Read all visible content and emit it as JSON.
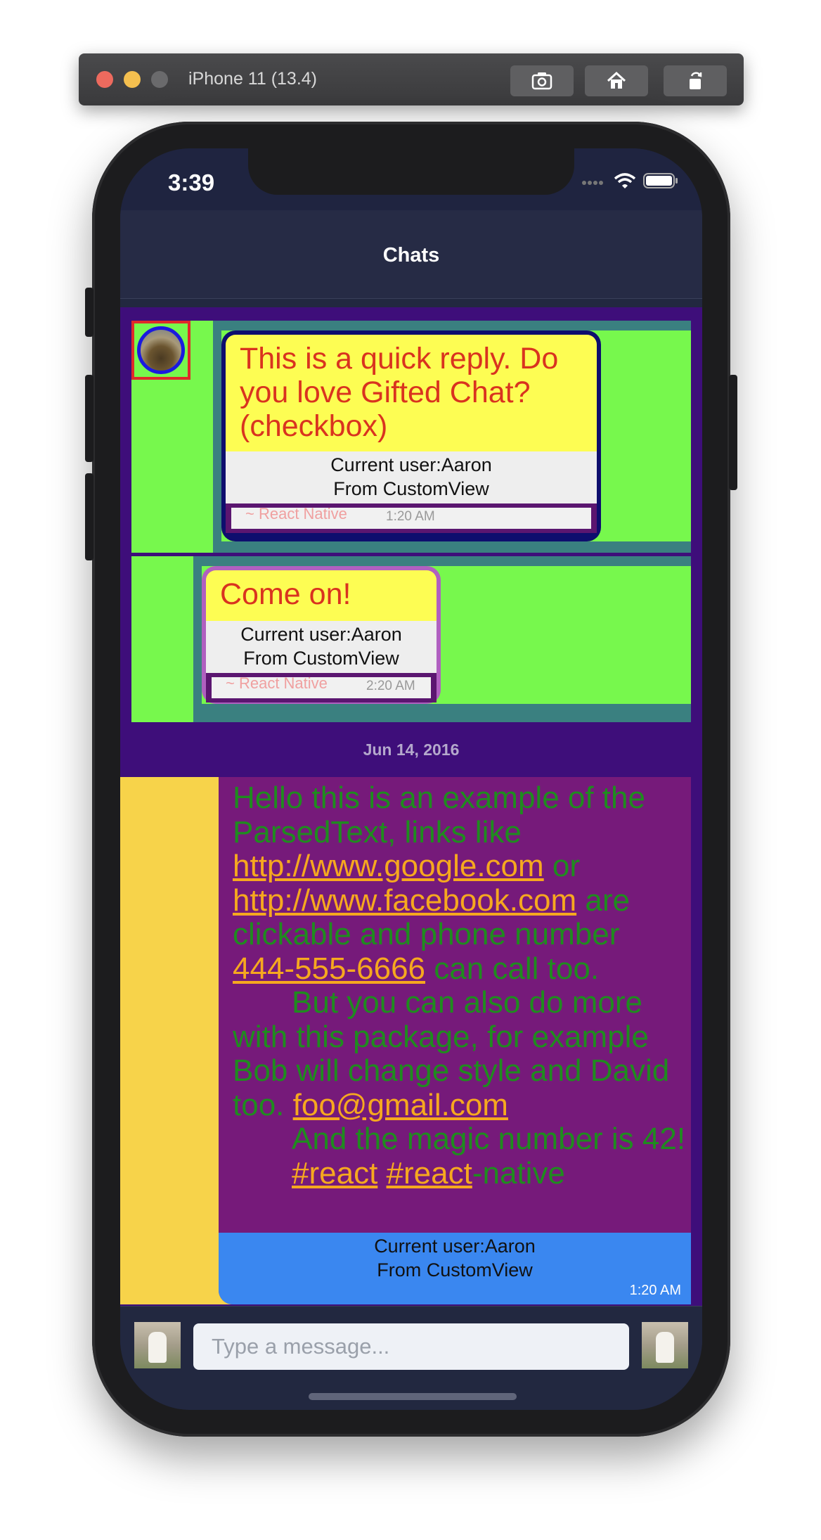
{
  "simulator": {
    "title": "iPhone 11 (13.4)",
    "buttons": [
      "screenshot-icon",
      "home-icon",
      "rotate-icon"
    ]
  },
  "status_bar": {
    "time": "3:39"
  },
  "nav": {
    "title": "Chats"
  },
  "messages": [
    {
      "text": "This is a quick reply. Do you love Gifted Chat? (checkbox)",
      "custom_view": [
        "Current user:Aaron",
        "From CustomView"
      ],
      "footer": "~ React Native",
      "time": "1:20 AM"
    },
    {
      "text": "Come on!",
      "custom_view": [
        "Current user:Aaron",
        "From CustomView"
      ],
      "footer": "~ React Native",
      "time": "2:20 AM"
    }
  ],
  "day_separator": "Jun 14, 2016",
  "parsed_message": {
    "p1_a": "Hello this is an example of the ParsedText, links like ",
    "link1": "http://www.google.com",
    "p1_b": " or ",
    "link2": "http://www.facebook.com",
    "p1_c": " are clickable and phone number ",
    "phone": "444-555-6666",
    "p1_d": " can call too.",
    "p2": "But you can also do more with this package, for example Bob will change style and David too. ",
    "email": "foo@gmail.com",
    "p3": "And the magic number is 42!",
    "hashtag1": "#react",
    "hashtag2": "#react",
    "hashtag_suffix": "-native",
    "custom_view": [
      "Current user:Aaron",
      "From CustomView"
    ],
    "time": "1:20 AM"
  },
  "composer": {
    "placeholder": "Type a message..."
  },
  "colors": {
    "chat_bg": "#3e0e7a",
    "green": "#77f84d",
    "teal": "#3a8080",
    "yellow": "#fdfd53",
    "purple_bubble": "#761a7a",
    "blue_custom": "#3a87f0",
    "left_yellow": "#f7d34a"
  }
}
